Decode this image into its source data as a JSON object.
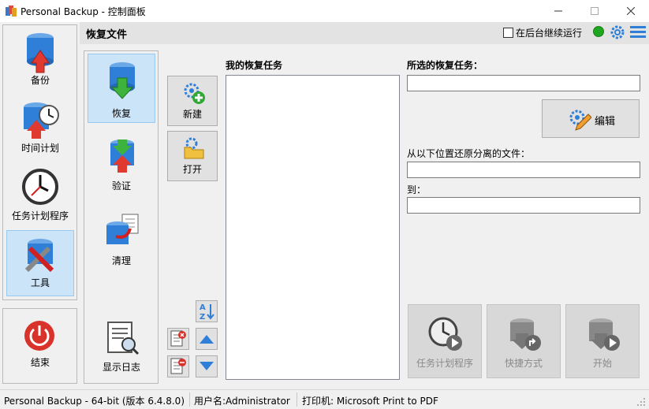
{
  "window": {
    "title": "Personal Backup - 控制面板",
    "minimize_icon": "minimize-icon",
    "maximize_icon": "maximize-icon",
    "close_icon": "close-icon"
  },
  "nav": {
    "items": [
      {
        "label": "备份",
        "icon": "database-upload-icon",
        "selected": false
      },
      {
        "label": "时间计划",
        "icon": "schedule-clock-icon",
        "selected": false
      },
      {
        "label": "任务计划程序",
        "icon": "clock-icon",
        "selected": false
      },
      {
        "label": "工具",
        "icon": "tools-icon",
        "selected": true
      }
    ],
    "exit_label": "结束"
  },
  "header": {
    "title": "恢复文件",
    "background_label": "在后台继续运行",
    "background_checked": false,
    "status_color": "#1fa51f"
  },
  "subnav": {
    "items": [
      {
        "label": "恢复",
        "icon": "database-restore-icon",
        "selected": true
      },
      {
        "label": "验证",
        "icon": "database-verify-icon",
        "selected": false
      },
      {
        "label": "清理",
        "icon": "cleanup-icon",
        "selected": false
      }
    ],
    "log_label": "显示日志"
  },
  "tools": {
    "new_label": "新建",
    "open_label": "打开"
  },
  "tasks": {
    "label": "我的恢复任务",
    "items": []
  },
  "form": {
    "selected_task_label": "所选的恢复任务：",
    "selected_task_value": "",
    "edit_label": "编辑",
    "from_label": "从以下位置还原分离的文件：",
    "from_value": "",
    "to_label": "到：",
    "to_value": ""
  },
  "actions": {
    "scheduler_label": "任务计划程序",
    "shortcut_label": "快捷方式",
    "start_label": "开始"
  },
  "statusbar": {
    "version": "Personal Backup - 64-bit (版本 6.4.8.0)",
    "user": "用户名:Administrator",
    "printer": "打印机: Microsoft Print to PDF"
  },
  "colors": {
    "accent_select": "#cce4f7",
    "status_green": "#1fa51f",
    "icon_blue": "#2f7fd8"
  }
}
